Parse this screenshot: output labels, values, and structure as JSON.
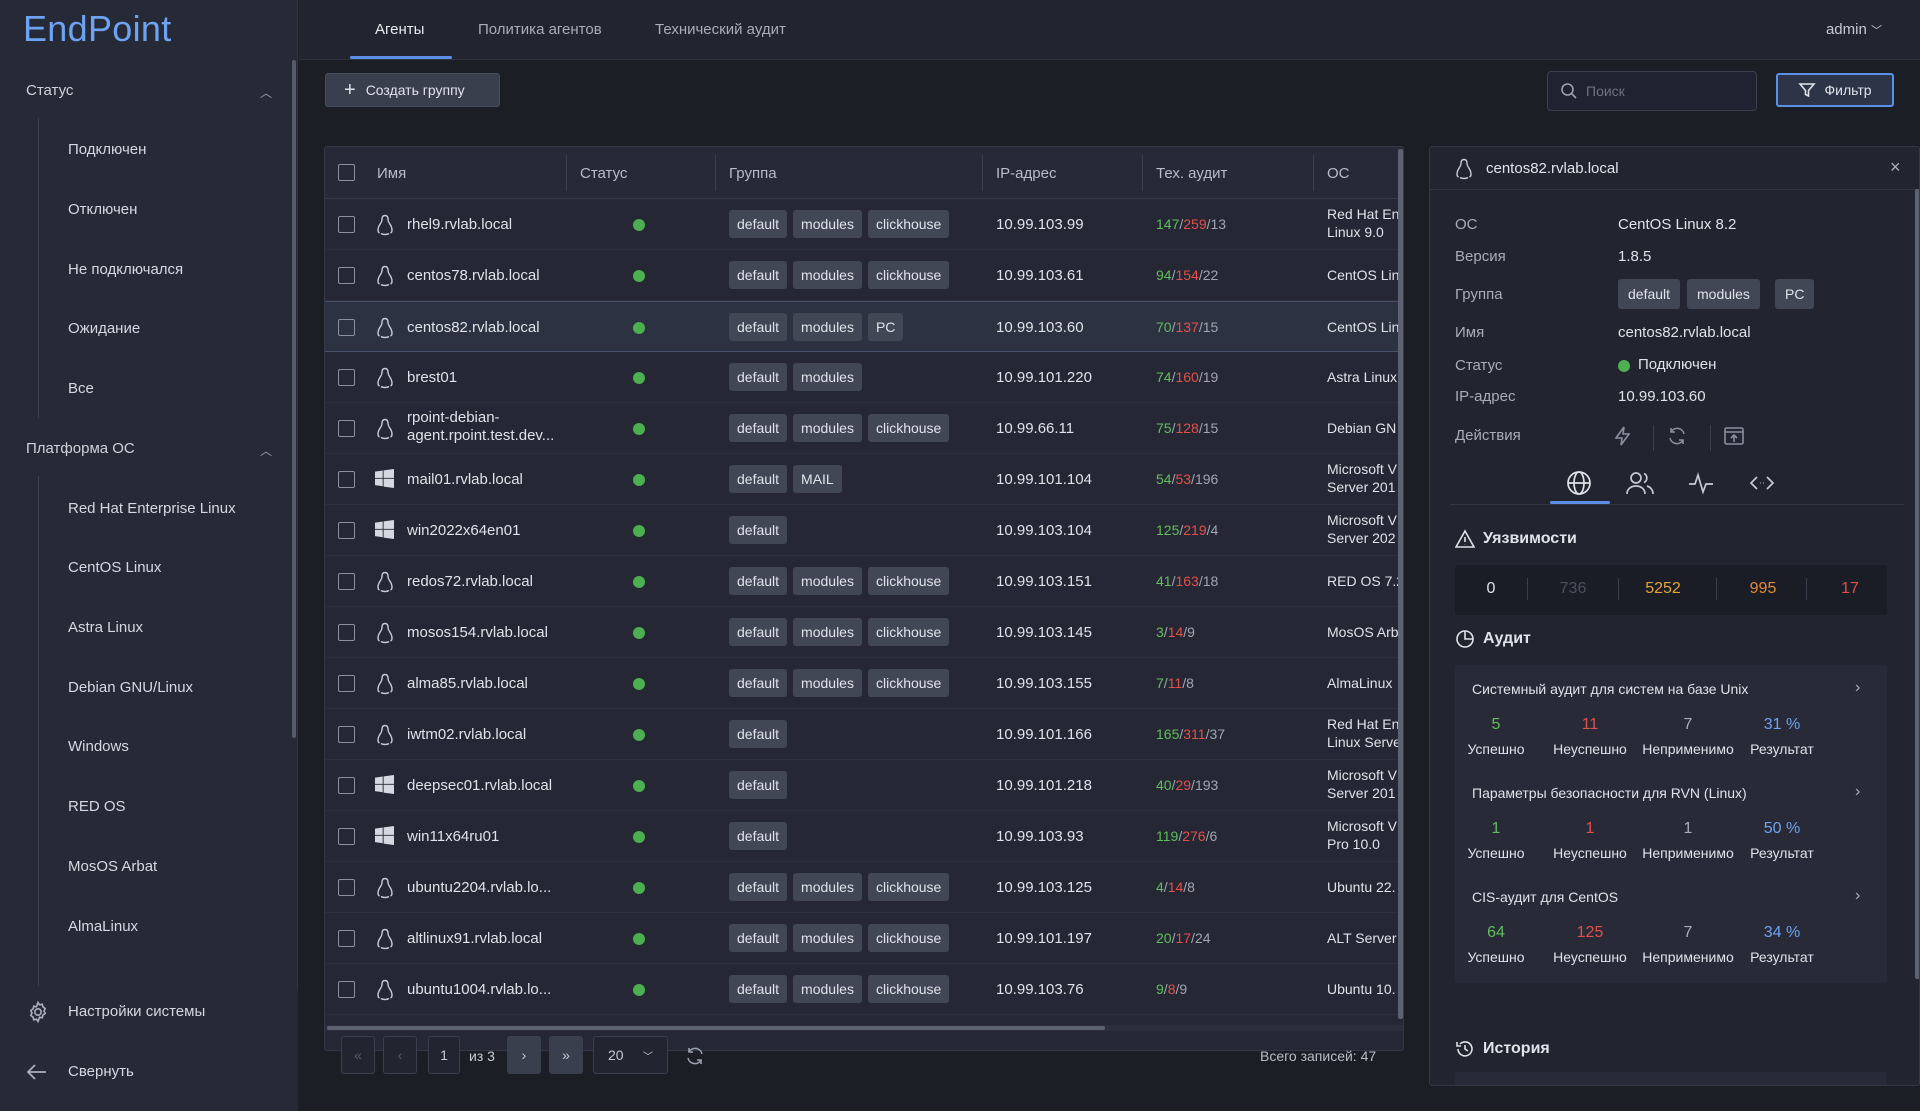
{
  "app": {
    "logo": "EndPoint"
  },
  "sidebar": {
    "status_title": "Статус",
    "status_items": [
      "Подключен",
      "Отключен",
      "Не подключался",
      "Ожидание",
      "Все"
    ],
    "os_title": "Платформа ОС",
    "os_items": [
      "Red Hat Enterprise Linux",
      "CentOS Linux",
      "Astra Linux",
      "Debian GNU/Linux",
      "Windows",
      "RED OS",
      "MosOS Arbat",
      "AlmaLinux"
    ],
    "settings": "Настройки системы",
    "collapse": "Свернуть"
  },
  "tabs": [
    "Агенты",
    "Политика агентов",
    "Технический аудит"
  ],
  "active_tab": "Агенты",
  "user": "admin",
  "toolbar": {
    "create_group": "Создать группу",
    "search_placeholder": "Поиск",
    "filter": "Фильтр"
  },
  "table": {
    "columns": [
      "Имя",
      "Статус",
      "Группа",
      "IP-адрес",
      "Тех. аудит",
      "ОС"
    ],
    "rows": [
      {
        "name": "rhel9.rvlab.local",
        "os_icon": "linux-icon",
        "groups": [
          "default",
          "modules",
          "clickhouse"
        ],
        "ip": "10.99.103.99",
        "audit": [
          147,
          259,
          13
        ],
        "os": [
          "Red Hat En",
          "Linux 9.0"
        ]
      },
      {
        "name": "centos78.rvlab.local",
        "os_icon": "linux-icon",
        "groups": [
          "default",
          "modules",
          "clickhouse"
        ],
        "ip": "10.99.103.61",
        "audit": [
          94,
          154,
          22
        ],
        "os": [
          "CentOS Lin"
        ]
      },
      {
        "name": "centos82.rvlab.local",
        "os_icon": "linux-icon",
        "groups": [
          "default",
          "modules",
          "PC"
        ],
        "ip": "10.99.103.60",
        "audit": [
          70,
          137,
          15
        ],
        "os": [
          "CentOS Lin"
        ],
        "selected": true
      },
      {
        "name": "brest01",
        "os_icon": "linux-icon",
        "groups": [
          "default",
          "modules"
        ],
        "ip": "10.99.101.220",
        "audit": [
          74,
          160,
          19
        ],
        "os": [
          "Astra Linux"
        ]
      },
      {
        "name": [
          "rpoint-debian-",
          "agent.rpoint.test.dev..."
        ],
        "os_icon": "linux-icon",
        "groups": [
          "default",
          "modules",
          "clickhouse"
        ],
        "ip": "10.99.66.11",
        "audit": [
          75,
          128,
          15
        ],
        "os": [
          "Debian GN"
        ]
      },
      {
        "name": "mail01.rvlab.local",
        "os_icon": "windows-icon",
        "groups": [
          "default",
          "MAIL"
        ],
        "ip": "10.99.101.104",
        "audit": [
          54,
          53,
          196
        ],
        "os": [
          "Microsoft V",
          "Server 201"
        ]
      },
      {
        "name": "win2022x64en01",
        "os_icon": "windows-icon",
        "groups": [
          "default"
        ],
        "ip": "10.99.103.104",
        "audit": [
          125,
          219,
          4
        ],
        "os": [
          "Microsoft V",
          "Server 202"
        ]
      },
      {
        "name": "redos72.rvlab.local",
        "os_icon": "linux-icon",
        "groups": [
          "default",
          "modules",
          "clickhouse"
        ],
        "ip": "10.99.103.151",
        "audit": [
          41,
          163,
          18
        ],
        "os": [
          "RED OS 7.2"
        ]
      },
      {
        "name": "mosos154.rvlab.local",
        "os_icon": "linux-icon",
        "groups": [
          "default",
          "modules",
          "clickhouse"
        ],
        "ip": "10.99.103.145",
        "audit": [
          3,
          14,
          9
        ],
        "os": [
          "MosOS Arb"
        ]
      },
      {
        "name": "alma85.rvlab.local",
        "os_icon": "linux-icon",
        "groups": [
          "default",
          "modules",
          "clickhouse"
        ],
        "ip": "10.99.103.155",
        "audit": [
          7,
          11,
          8
        ],
        "os": [
          "AlmaLinux"
        ]
      },
      {
        "name": "iwtm02.rvlab.local",
        "os_icon": "linux-icon",
        "groups": [
          "default"
        ],
        "ip": "10.99.101.166",
        "audit": [
          165,
          311,
          37
        ],
        "os": [
          "Red Hat En",
          "Linux Serve"
        ]
      },
      {
        "name": "deepsec01.rvlab.local",
        "os_icon": "windows-icon",
        "groups": [
          "default"
        ],
        "ip": "10.99.101.218",
        "audit": [
          40,
          29,
          193
        ],
        "os": [
          "Microsoft V",
          "Server 201"
        ]
      },
      {
        "name": "win11x64ru01",
        "os_icon": "windows-icon",
        "groups": [
          "default"
        ],
        "ip": "10.99.103.93",
        "audit": [
          119,
          276,
          6
        ],
        "os": [
          "Microsoft V",
          "Pro 10.0"
        ]
      },
      {
        "name": "ubuntu2204.rvlab.lo...",
        "os_icon": "linux-icon",
        "groups": [
          "default",
          "modules",
          "clickhouse"
        ],
        "ip": "10.99.103.125",
        "audit": [
          4,
          14,
          8
        ],
        "os": [
          "Ubuntu 22."
        ]
      },
      {
        "name": "altlinux91.rvlab.local",
        "os_icon": "linux-icon",
        "groups": [
          "default",
          "modules",
          "clickhouse"
        ],
        "ip": "10.99.101.197",
        "audit": [
          20,
          17,
          24
        ],
        "os": [
          "ALT Server"
        ]
      },
      {
        "name": "ubuntu1004.rvlab.lo...",
        "os_icon": "linux-icon",
        "groups": [
          "default",
          "modules",
          "clickhouse"
        ],
        "ip": "10.99.103.76",
        "audit": [
          9,
          8,
          9
        ],
        "os": [
          "Ubuntu 10."
        ]
      }
    ]
  },
  "pagination": {
    "page": "1",
    "of_label": "из 3",
    "page_size": "20",
    "total": "Всего записей: 47"
  },
  "panel": {
    "title": "centos82.rvlab.local",
    "fields": [
      {
        "k": "ОС",
        "v": "CentOS Linux 8.2"
      },
      {
        "k": "Версия",
        "v": "1.8.5"
      },
      {
        "k": "Группа",
        "v": ""
      },
      {
        "k": "Имя",
        "v": "centos82.rvlab.local"
      },
      {
        "k": "Статус",
        "v": "Подключен"
      },
      {
        "k": "IP-адрес",
        "v": "10.99.103.60"
      },
      {
        "k": "Действия",
        "v": ""
      }
    ],
    "groups": [
      "default",
      "modules",
      "PC"
    ],
    "vuln_title": "Уязвимости",
    "vuln": [
      "0",
      "736",
      "5252",
      "995",
      "17"
    ],
    "vuln_colors": [
      "#e0e3ea",
      "#4c5160",
      "#e3a43a",
      "#e08a3a",
      "#e2504a"
    ],
    "audit_title": "Аудит",
    "audit_cards": [
      {
        "title": "Системный аудит для систем на базе Unix",
        "vals": [
          "5",
          "11",
          "7",
          "31 %"
        ]
      },
      {
        "title": "Параметры безопасности для RVN (Linux)",
        "vals": [
          "1",
          "1",
          "1",
          "50 %"
        ]
      },
      {
        "title": "CIS-аудит для CentOS",
        "vals": [
          "64",
          "125",
          "7",
          "34 %"
        ]
      }
    ],
    "audit_labels": [
      "Успешно",
      "Неуспешно",
      "Неприменимо",
      "Результат"
    ],
    "history_title": "История"
  },
  "colors": {
    "accent": "#5b8fe8",
    "success": "#5fbf5a",
    "danger": "#e2504a",
    "online": "#4caf50"
  }
}
